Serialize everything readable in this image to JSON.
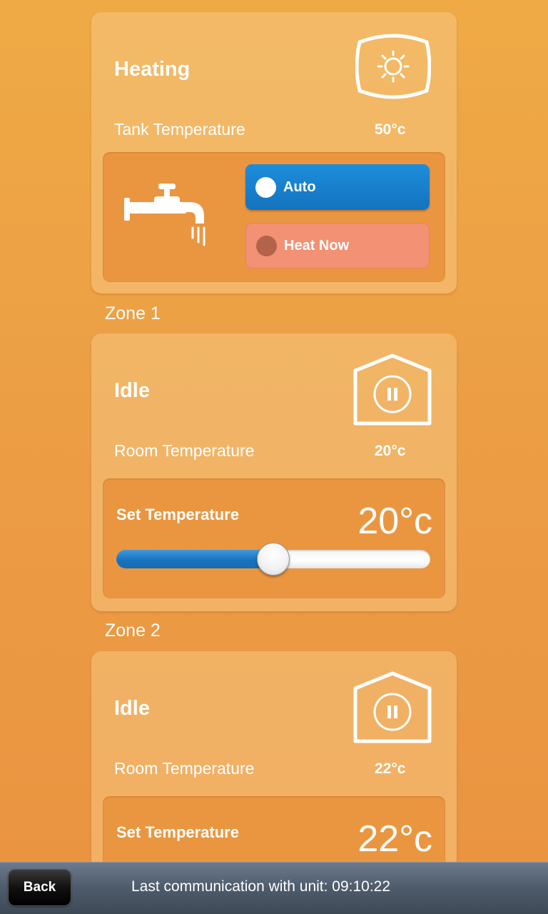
{
  "heating": {
    "title": "Heating",
    "tank_label": "Tank Temperature",
    "tank_value": "50°c",
    "icon": "sun-icon",
    "modes": [
      {
        "label": "Auto",
        "active": true
      },
      {
        "label": "Heat Now",
        "active": false
      }
    ]
  },
  "zones": [
    {
      "name": "Zone 1",
      "status": "Idle",
      "room_label": "Room Temperature",
      "room_value": "20°c",
      "set_label": "Set Temperature",
      "set_value": "20°c",
      "slider_level": 0.5
    },
    {
      "name": "Zone 2",
      "status": "Idle",
      "room_label": "Room Temperature",
      "room_value": "22°c",
      "set_label": "Set Temperature",
      "set_value": "22°c"
    }
  ],
  "footer": {
    "back_label": "Back",
    "status": "Last communication with unit: 09:10:22"
  },
  "colors": {
    "background": "#EC9E45",
    "accent_blue": "#1473BE",
    "heat_now": "#F29173"
  }
}
